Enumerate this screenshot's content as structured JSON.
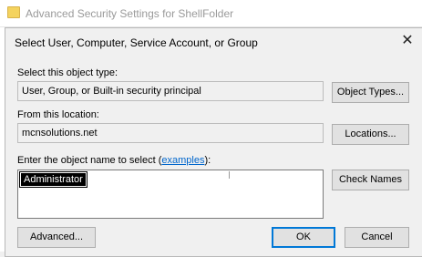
{
  "parent_window": {
    "title": "Advanced Security Settings for ShellFolder"
  },
  "dialog": {
    "title": "Select User, Computer, Service Account, or Group",
    "close_symbol": "✕",
    "object_type": {
      "label": "Select this object type:",
      "value": "User, Group, or Built-in security principal",
      "button": "Object Types..."
    },
    "location": {
      "label": "From this location:",
      "value": "mcnsolutions.net",
      "button": "Locations..."
    },
    "object_names": {
      "label_before": "Enter the object name to select (",
      "link": "examples",
      "label_after": "):",
      "value": "Administrator",
      "check_button": "Check Names"
    },
    "buttons": {
      "advanced": "Advanced...",
      "ok": "OK",
      "cancel": "Cancel"
    }
  },
  "icons": {
    "folder": "folder-icon",
    "close": "close-icon"
  }
}
